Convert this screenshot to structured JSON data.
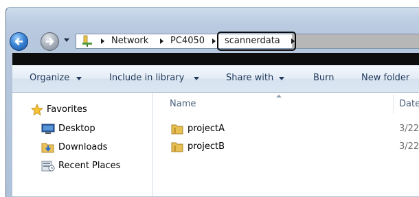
{
  "address": {
    "crumbs": [
      "Network",
      "PC4050",
      "scannerdata"
    ]
  },
  "toolbar": {
    "organize": "Organize",
    "include_in_library": "Include in library",
    "share_with": "Share with",
    "burn": "Burn",
    "new_folder": "New folder"
  },
  "nav": {
    "favorites": "Favorites",
    "items": [
      "Desktop",
      "Downloads",
      "Recent Places"
    ]
  },
  "columns": {
    "name": "Name",
    "date": "Date"
  },
  "files": [
    {
      "name": "projectA",
      "date": "3/22"
    },
    {
      "name": "projectB",
      "date": "3/22"
    }
  ],
  "colors": {
    "accent": "#1e395b",
    "highlight_border": "#0a0a0a"
  }
}
